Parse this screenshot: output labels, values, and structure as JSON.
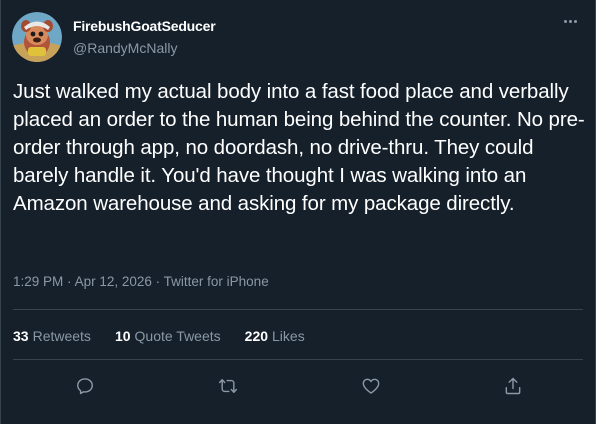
{
  "tweet": {
    "author": {
      "display_name": "FirebushGoatSeducer",
      "handle": "@RandyMcNally",
      "avatar_icon": "cartoon-avatar-icon"
    },
    "text": "Just walked my actual body into a fast food place and verbally placed an order to the human being behind the counter. No pre-order through app, no doordash, no drive-thru. They could barely handle it. You'd have thought I was walking into an Amazon warehouse and asking for my package directly.",
    "time": "1:29 PM",
    "date": "Apr 12, 2026",
    "separator": "·",
    "source": "Twitter for iPhone",
    "stats": {
      "retweets_count": "33",
      "retweets_label": "Retweets",
      "quotes_count": "10",
      "quotes_label": "Quote Tweets",
      "likes_count": "220",
      "likes_label": "Likes"
    },
    "actions": [
      "reply-icon",
      "retweet-icon",
      "like-icon",
      "share-icon"
    ]
  },
  "colors": {
    "background": "#15202b",
    "text_primary": "#ffffff",
    "text_secondary": "#8b98a5",
    "divider": "#38444d"
  }
}
